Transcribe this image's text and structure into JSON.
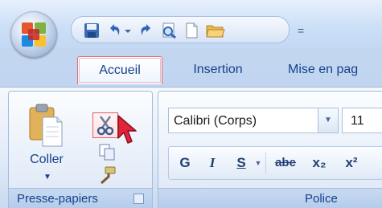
{
  "quick_access": {
    "icons": [
      "save-icon",
      "undo-icon",
      "dropdown-arrow-icon",
      "redo-icon",
      "print-preview-icon",
      "new-document-icon",
      "open-folder-icon"
    ],
    "customize_glyph": "="
  },
  "tabs": [
    {
      "label": "Accueil",
      "active": true
    },
    {
      "label": "Insertion",
      "active": false
    },
    {
      "label": "Mise en pag",
      "active": false
    }
  ],
  "clipboard_group": {
    "paste_label": "Coller",
    "group_label": "Presse-papiers"
  },
  "font_group": {
    "font_name": "Calibri (Corps)",
    "font_size": "11",
    "group_label": "Police",
    "format_buttons": [
      "G",
      "I",
      "S",
      "abe",
      "x₂",
      "x²"
    ]
  },
  "colors": {
    "tab_text": "#15428b",
    "active_tab_border": "#d96f7a",
    "cut_highlight": "#e05b6b",
    "cursor": "#e0243a"
  }
}
